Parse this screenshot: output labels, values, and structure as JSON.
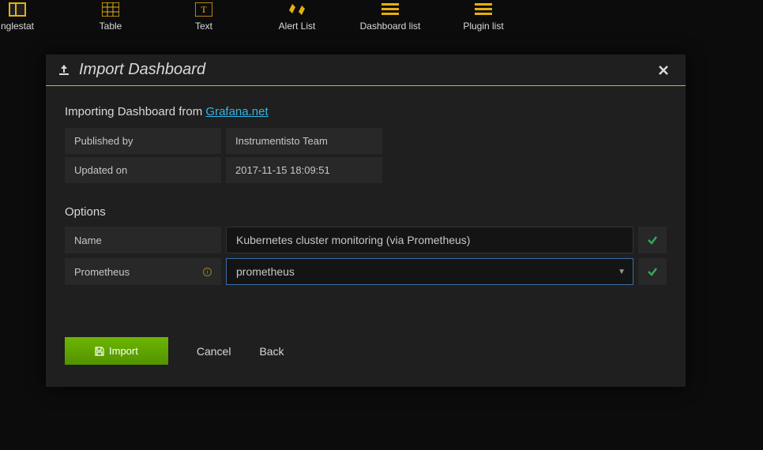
{
  "panels": {
    "singlestat": "nglestat",
    "table": "Table",
    "text": "Text",
    "alert_list": "Alert List",
    "dashboard_list": "Dashboard list",
    "plugin_list": "Plugin list"
  },
  "modal": {
    "title": "Import Dashboard",
    "importing_prefix": "Importing Dashboard from ",
    "importing_link": "Grafana.net",
    "published_by_label": "Published by",
    "published_by_value": "Instrumentisto Team",
    "updated_on_label": "Updated on",
    "updated_on_value": "2017-11-15 18:09:51",
    "options_title": "Options",
    "name_label": "Name",
    "name_value": "Kubernetes cluster monitoring (via Prometheus)",
    "prometheus_label": "Prometheus",
    "prometheus_value": "prometheus",
    "import_button": "Import",
    "cancel_button": "Cancel",
    "back_button": "Back"
  }
}
